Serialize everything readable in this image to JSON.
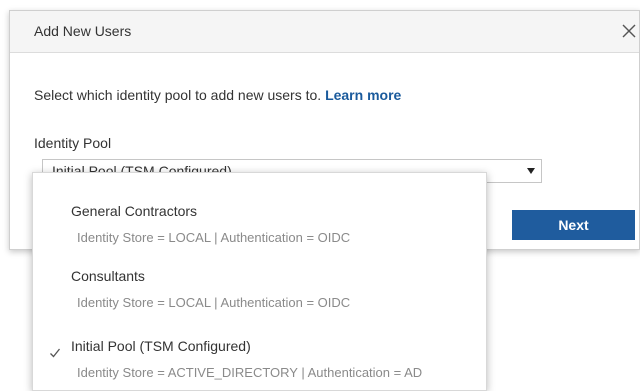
{
  "dialog": {
    "title": "Add New Users",
    "instructions": "Select which identity pool to add new users to.",
    "learn_more": "Learn more",
    "field_label": "Identity Pool",
    "selected_value": "Initial Pool (TSM Configured)",
    "next_label": "Next",
    "close_icon": "close-icon",
    "dropdown_icon": "chevron-down-icon"
  },
  "dropdown": {
    "options": [
      {
        "name": "General Contractors",
        "detail": "Identity Store = LOCAL | Authentication = OIDC",
        "selected": false
      },
      {
        "name": "Consultants",
        "detail": "Identity Store = LOCAL | Authentication = OIDC",
        "selected": false
      },
      {
        "name": "Initial Pool (TSM Configured)",
        "detail": "Identity Store = ACTIVE_DIRECTORY | Authentication = AD",
        "selected": true
      }
    ]
  },
  "colors": {
    "accent": "#1f5c9e",
    "link": "#1a5a9c",
    "header_bg": "#f5f5f5",
    "muted_text": "#8a8a8a"
  }
}
